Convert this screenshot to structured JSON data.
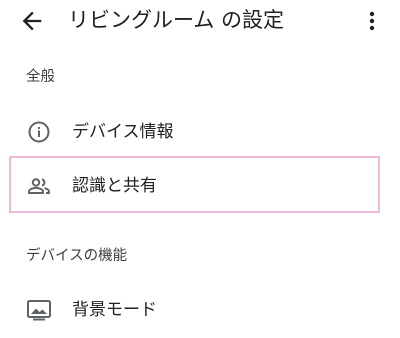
{
  "app_bar": {
    "back_icon": "arrow-back-icon",
    "title": "リビングルーム の設定",
    "more_icon": "more-vert-icon"
  },
  "sections": [
    {
      "header": "全般",
      "items": [
        {
          "label": "デバイス情報",
          "icon": "info-icon"
        },
        {
          "label": "認識と共有",
          "icon": "people-icon",
          "highlighted": true
        }
      ]
    },
    {
      "header": "デバイスの機能",
      "items": [
        {
          "label": "背景モード",
          "icon": "photo-frame-icon"
        }
      ]
    }
  ],
  "colors": {
    "text_primary": "#202124",
    "text_secondary": "#3c4043",
    "icon": "#5f6368",
    "highlight_border": "#f2b8d8"
  }
}
